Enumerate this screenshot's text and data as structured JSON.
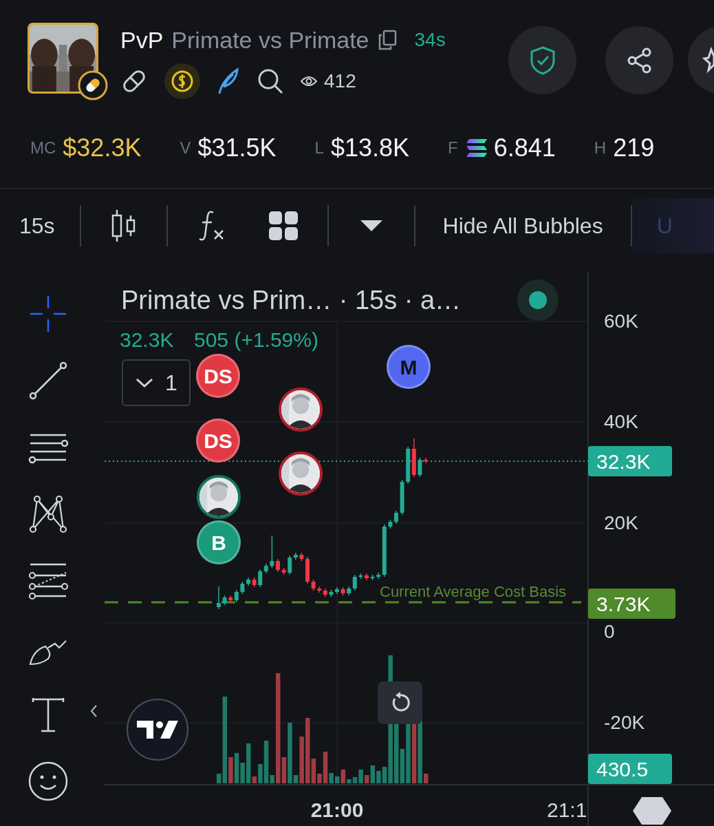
{
  "token": {
    "symbol": "PvP",
    "name": "Primate vs Primate",
    "age": "34s",
    "views": "412"
  },
  "stats": [
    {
      "label": "MC",
      "value": "$32.3K",
      "highlight": true,
      "kind": "plain"
    },
    {
      "label": "V",
      "value": "$31.5K",
      "highlight": false,
      "kind": "plain"
    },
    {
      "label": "L",
      "value": "$13.8K",
      "highlight": false,
      "kind": "plain"
    },
    {
      "label": "F",
      "value": "6.841",
      "highlight": false,
      "kind": "coin"
    },
    {
      "label": "H",
      "value": "219",
      "highlight": false,
      "kind": "plain"
    }
  ],
  "toolbar": {
    "interval": "15s",
    "bubbles_button": "Hide All Bubbles",
    "cut_label": "U"
  },
  "tools": [
    {
      "kind": "crosshair",
      "selected": true
    },
    {
      "kind": "line",
      "selected": false
    },
    {
      "kind": "hlines",
      "selected": false
    },
    {
      "kind": "pattern",
      "selected": false
    },
    {
      "kind": "fib",
      "selected": false
    },
    {
      "kind": "brush",
      "selected": false
    },
    {
      "kind": "text",
      "selected": false
    },
    {
      "kind": "emoji",
      "selected": false
    }
  ],
  "chart": {
    "title": "Primate vs Prim… · 15s · a…",
    "live": true,
    "last": "32.3K",
    "change": "505 (+1.59%)",
    "collapse_count": "1",
    "bubbles": [
      {
        "kind": "label",
        "text": "DS",
        "color": "#e23a45"
      },
      {
        "kind": "picture",
        "color": "#b01f2a"
      },
      {
        "kind": "label",
        "text": "DS",
        "color": "#e23a45"
      },
      {
        "kind": "picture",
        "color": "#b01f2a"
      },
      {
        "kind": "picture",
        "color": "#11745c"
      },
      {
        "kind": "label",
        "text": "B",
        "color": "#1b9a7c"
      },
      {
        "kind": "label",
        "text": "M",
        "color": "#5368f0"
      }
    ],
    "price_labels": [
      "60K",
      "40K",
      "20K",
      "0",
      "-20K"
    ],
    "price_badges": [
      {
        "text": "32.3K",
        "color": "#22ab94"
      },
      {
        "text": "3.73K",
        "color": "#4f8a2b"
      },
      {
        "text": "430.5",
        "color": "#22ab94"
      }
    ],
    "cost_basis_label": "Current Average Cost Basis",
    "time_labels": [
      {
        "text": "21:00",
        "bold": true
      },
      {
        "text": "21:1",
        "bold": false
      }
    ]
  }
}
